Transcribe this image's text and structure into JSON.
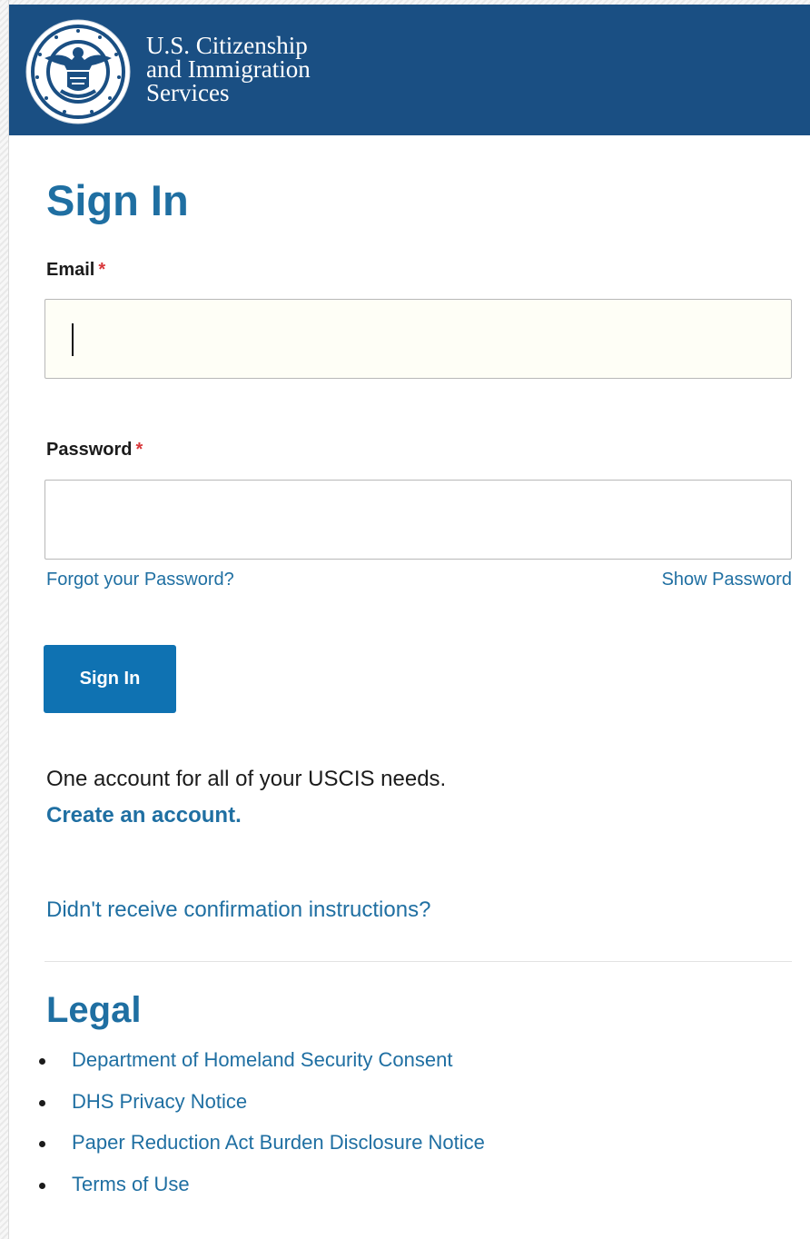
{
  "header": {
    "agency_line1": "U.S. Citizenship",
    "agency_line2": "and Immigration",
    "agency_line3": "Services",
    "logo": "dhs-seal-icon",
    "background": "#1a4f83"
  },
  "form": {
    "title": "Sign In",
    "email_label": "Email",
    "password_label": "Password",
    "required_marker": "*",
    "email_value": "",
    "password_value": "",
    "forgot_link": "Forgot your Password?",
    "show_password_link": "Show Password",
    "submit_label": "Sign In"
  },
  "account": {
    "promo_text": "One account for all of your USCIS needs.",
    "create_link": "Create an account.",
    "resend_link": "Didn't receive confirmation instructions?"
  },
  "legal": {
    "title": "Legal",
    "links": [
      "Department of Homeland Security Consent",
      "DHS Privacy Notice",
      "Paper Reduction Act Burden Disclosure Notice",
      "Terms of Use"
    ]
  },
  "colors": {
    "accent": "#1f6fa2",
    "button": "#0f72b2",
    "required": "#d8383b"
  }
}
